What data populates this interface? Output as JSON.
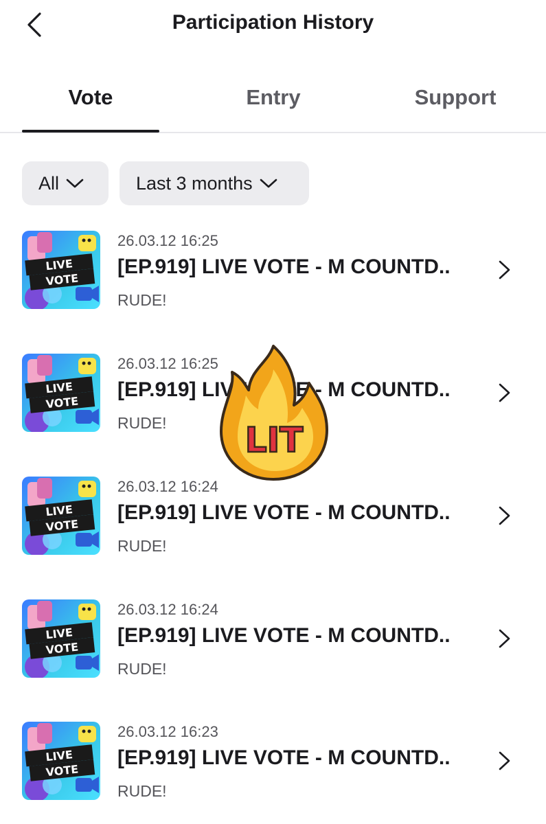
{
  "header": {
    "title": "Participation History",
    "back_icon": "chevron-left-icon"
  },
  "tabs": [
    {
      "label": "Vote",
      "active": true
    },
    {
      "label": "Entry",
      "active": false
    },
    {
      "label": "Support",
      "active": false
    }
  ],
  "filters": {
    "type": "All",
    "period": "Last 3 months",
    "icon": "chevron-down-icon"
  },
  "items": [
    {
      "date": "26.03.12 16:25",
      "title": "[EP.919] LIVE VOTE - M COUNTD..",
      "artist": "RUDE!",
      "thumb_label_1": "LIVE",
      "thumb_label_2": "VOTE"
    },
    {
      "date": "26.03.12 16:25",
      "title": "[EP.919] LIVE VOTE - M COUNTD..",
      "artist": "RUDE!",
      "thumb_label_1": "LIVE",
      "thumb_label_2": "VOTE"
    },
    {
      "date": "26.03.12 16:24",
      "title": "[EP.919] LIVE VOTE - M COUNTD..",
      "artist": "RUDE!",
      "thumb_label_1": "LIVE",
      "thumb_label_2": "VOTE"
    },
    {
      "date": "26.03.12 16:24",
      "title": "[EP.919] LIVE VOTE - M COUNTD..",
      "artist": "RUDE!",
      "thumb_label_1": "LIVE",
      "thumb_label_2": "VOTE"
    },
    {
      "date": "26.03.12 16:23",
      "title": "[EP.919] LIVE VOTE - M COUNTD..",
      "artist": "RUDE!",
      "thumb_label_1": "LIVE",
      "thumb_label_2": "VOTE"
    }
  ],
  "sticker": {
    "text": "LIT",
    "icon": "fire-icon"
  },
  "colors": {
    "text_primary": "#1b1b1f",
    "text_secondary": "#55555a",
    "filter_bg": "#ececef",
    "tab_divider": "#e6e6ea"
  }
}
